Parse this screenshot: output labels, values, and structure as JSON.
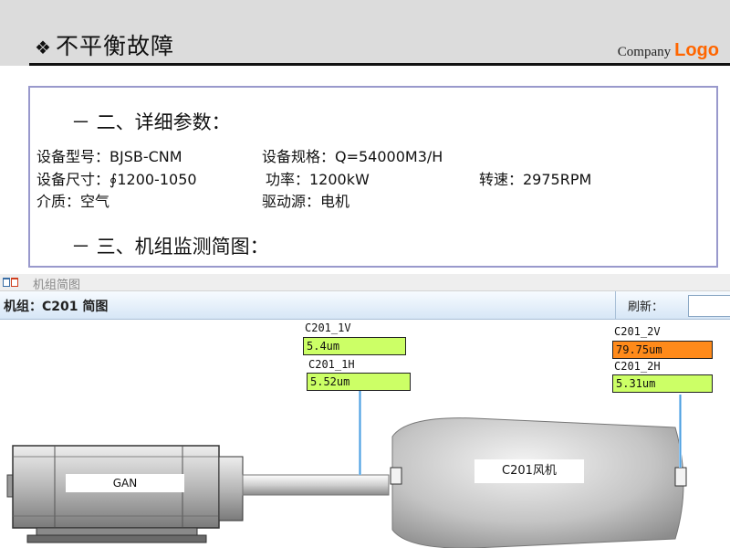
{
  "slide": {
    "bullet": "❖",
    "title": "不平衡故障",
    "company_text": "Company",
    "logo_text": "Logo"
  },
  "details": {
    "section2_title": "－ 二、详细参数：",
    "model": "设备型号：BJSB-CNM",
    "spec": "设备规格：Q=54000M3/H",
    "size": "设备尺寸：∮1200-1050",
    "power": "功率：1200kW",
    "speed": "转速：2975RPM",
    "medium": "介质：空气",
    "drive": "驱动源：电机",
    "section3_title": "－ 三、机组监测简图："
  },
  "window": {
    "title": "机组简图",
    "unit_label": "机组：C201 简图",
    "refresh_label": "刷新：",
    "refresh_value": ""
  },
  "diagram": {
    "motor_label": "GAN",
    "fan_label": "C201风机",
    "sensors": [
      {
        "id": "C201_1V",
        "value": "5.4um",
        "color": "#ccff66"
      },
      {
        "id": "C201_1H",
        "value": "5.52um",
        "color": "#ccff66"
      },
      {
        "id": "C201_2V",
        "value": "79.75um",
        "color": "#ff8a1a"
      },
      {
        "id": "C201_2H",
        "value": "5.31um",
        "color": "#ccff66"
      }
    ]
  }
}
